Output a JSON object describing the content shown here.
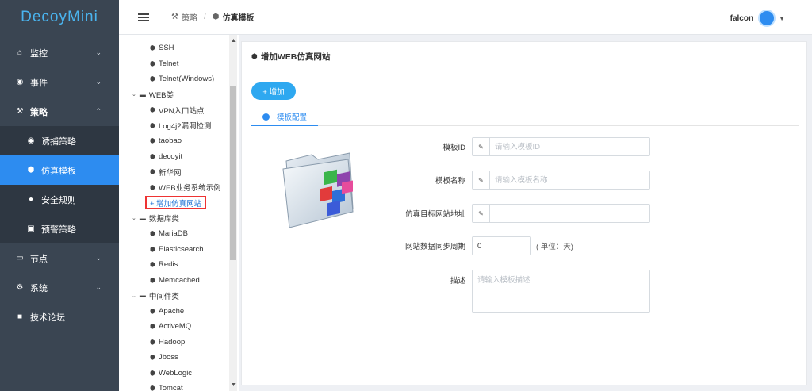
{
  "app": {
    "logo": "DecoyMini"
  },
  "sidebar": {
    "items": [
      {
        "icon": "home-icon",
        "glyph": "⌂",
        "label": "监控"
      },
      {
        "icon": "target-icon",
        "glyph": "◉",
        "label": "事件"
      },
      {
        "icon": "tools-icon",
        "glyph": "⚒",
        "label": "策略"
      },
      {
        "icon": "node-icon",
        "glyph": "▭",
        "label": "节点"
      },
      {
        "icon": "gear-icon",
        "glyph": "⚙",
        "label": "系统"
      },
      {
        "icon": "forum-icon",
        "glyph": "■",
        "label": "技术论坛"
      }
    ],
    "subitems": [
      {
        "label": "诱捕策略"
      },
      {
        "label": "仿真模板"
      },
      {
        "label": "安全规则"
      },
      {
        "label": "预警策略"
      }
    ]
  },
  "header": {
    "breadcrumb_parent": "策略",
    "breadcrumb_current": "仿真模板",
    "user": "falcon"
  },
  "tree": {
    "n0": "SSH",
    "n1": "Telnet",
    "n2": "Telnet(Windows)",
    "g_web": "WEB类",
    "n3": "VPN入口站点",
    "n4": "Log4j2漏洞检测",
    "n5": "taobao",
    "n6": "decoyit",
    "n7": "新华网",
    "n8": "WEB业务系统示例",
    "add": "+ 增加仿真网站",
    "g_db": "数据库类",
    "n9": "MariaDB",
    "n10": "Elasticsearch",
    "n11": "Redis",
    "n12": "Memcached",
    "g_mw": "中间件类",
    "n13": "Apache",
    "n14": "ActiveMQ",
    "n15": "Hadoop",
    "n16": "Jboss",
    "n17": "WebLogic",
    "n18": "Tomcat"
  },
  "panel": {
    "title": "增加WEB仿真网站",
    "add_button": "+ 增加",
    "tab": "模板配置"
  },
  "form": {
    "id_label": "模板ID",
    "id_placeholder": "请输入模板ID",
    "name_label": "模板名称",
    "name_placeholder": "请输入模板名称",
    "url_label": "仿真目标网站地址",
    "url_value": "",
    "sync_label": "网站数据同步周期",
    "sync_value": "0",
    "sync_unit": "( 单位：天)",
    "desc_label": "描述",
    "desc_placeholder": "请输入模板描述"
  }
}
